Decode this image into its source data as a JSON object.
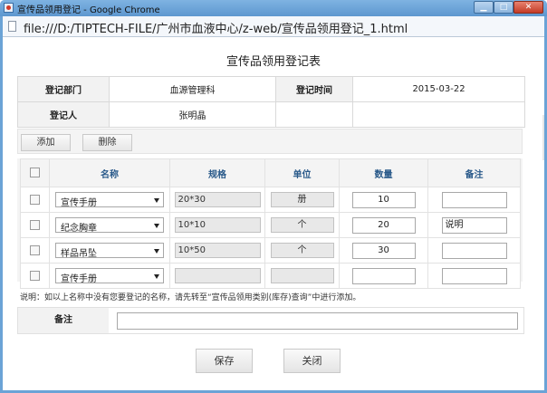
{
  "window": {
    "title": "宣传品领用登记 - Google Chrome",
    "controls": {
      "minimize": "▁",
      "maximize": "□",
      "close": "✕"
    }
  },
  "address": {
    "url": "file:///D:/TIPTECH-FILE/广州市血液中心/z-web/宣传品领用登记_1.html"
  },
  "page": {
    "title": "宣传品领用登记表"
  },
  "info": {
    "dept_label": "登记部门",
    "dept_value": "血源管理科",
    "time_label": "登记时间",
    "time_value": "2015-03-22",
    "person_label": "登记人",
    "person_value": "张明晶"
  },
  "toolbar": {
    "add_label": "添加",
    "delete_label": "删除"
  },
  "grid": {
    "headers": [
      "名称",
      "规格",
      "单位",
      "数量",
      "备注"
    ],
    "rows": [
      {
        "name": "宣传手册",
        "spec": "20*30",
        "unit": "册",
        "qty": "10",
        "note": ""
      },
      {
        "name": "纪念胸章",
        "spec": "10*10",
        "unit": "个",
        "qty": "20",
        "note": "说明"
      },
      {
        "name": "样品吊坠",
        "spec": "10*50",
        "unit": "个",
        "qty": "30",
        "note": ""
      },
      {
        "name": "宣传手册",
        "spec": "",
        "unit": "",
        "qty": "",
        "note": ""
      }
    ]
  },
  "hint": "说明：如以上名称中没有您要登记的名称，请先转至“宣传品领用类别(库存)查询”中进行添加。",
  "remarks": {
    "label": "备注",
    "value": ""
  },
  "actions": {
    "save_label": "保存",
    "close_label": "关闭"
  }
}
